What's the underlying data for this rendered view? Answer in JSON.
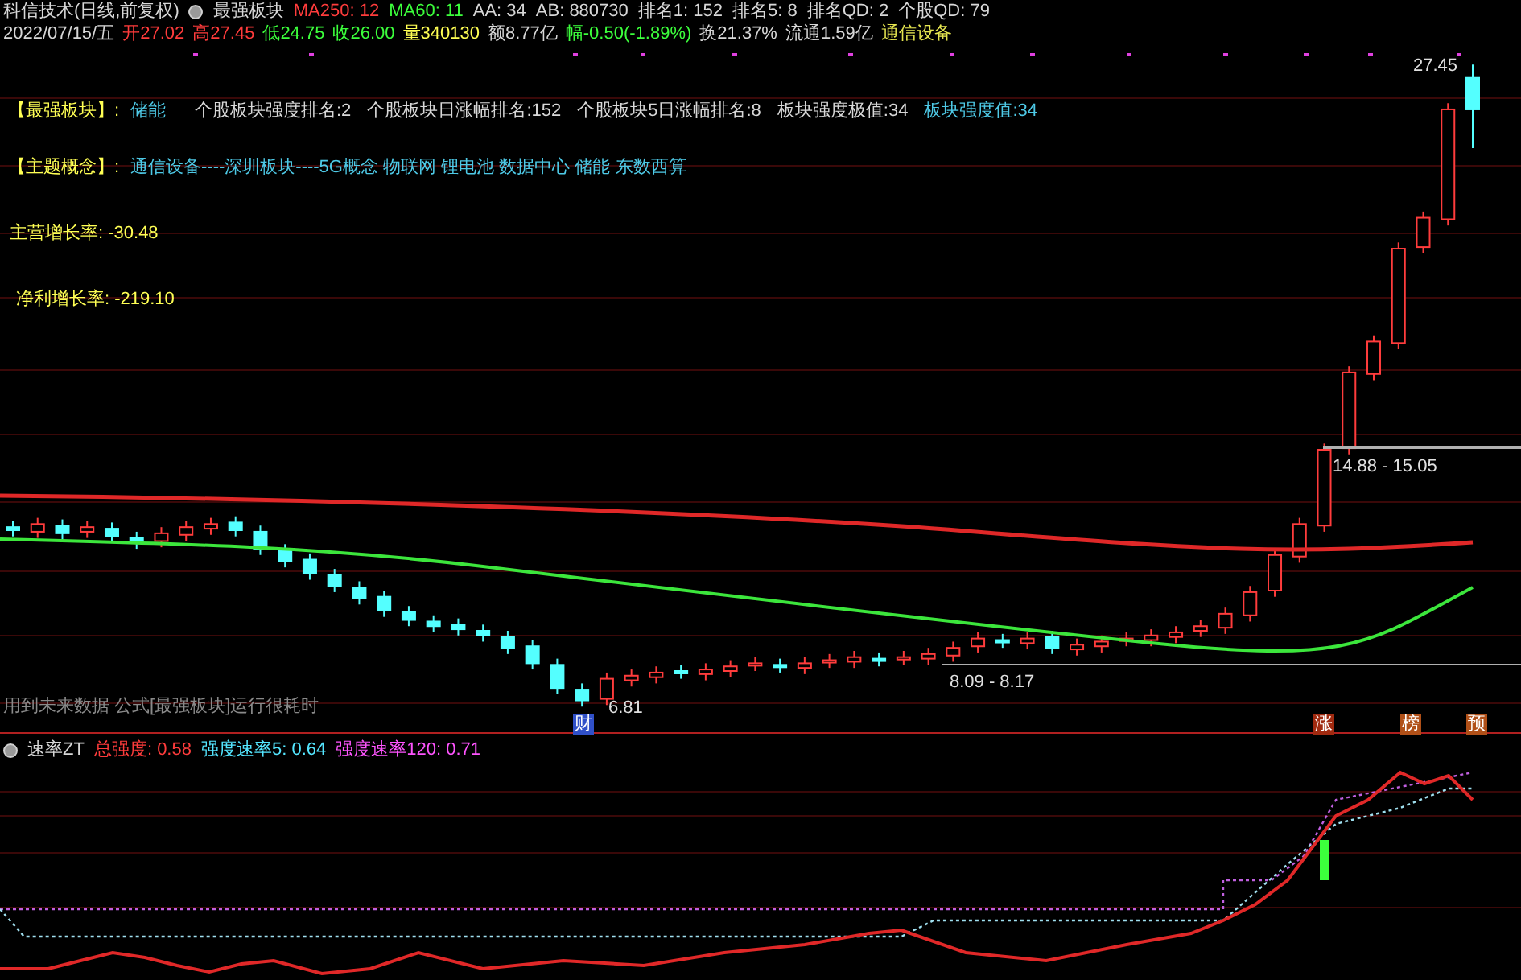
{
  "header": {
    "items": [
      {
        "text": "科信技术(日线,前复权)",
        "color": "#d8d8d8"
      },
      {
        "text": "最强板块",
        "color": "#d8d8d8"
      },
      {
        "text": "MA250: 12",
        "color": "#ff3c3c"
      },
      {
        "text": "MA60: 11",
        "color": "#3cff3c"
      },
      {
        "text": "AA: 34",
        "color": "#d8d8d8"
      },
      {
        "text": "AB: 880730",
        "color": "#d8d8d8"
      },
      {
        "text": "排名1: 152",
        "color": "#d8d8d8"
      },
      {
        "text": "排名5: 8",
        "color": "#d8d8d8"
      },
      {
        "text": "排名QD: 2",
        "color": "#d8d8d8"
      },
      {
        "text": "个股QD: 79",
        "color": "#d8d8d8"
      }
    ]
  },
  "quote": [
    {
      "text": "2022/07/15/五",
      "color": "#d8d8d8"
    },
    {
      "text": "开27.02",
      "color": "#ff3c3c"
    },
    {
      "text": "高27.45",
      "color": "#ff3c3c"
    },
    {
      "text": "低24.75",
      "color": "#3cff3c"
    },
    {
      "text": "收26.00",
      "color": "#3cff3c"
    },
    {
      "text": "量340130",
      "color": "#ffff54"
    },
    {
      "text": "额8.77亿",
      "color": "#d8d8d8"
    },
    {
      "text": "幅-0.50(-1.89%)",
      "color": "#3cff3c"
    },
    {
      "text": "换21.37%",
      "color": "#d8d8d8"
    },
    {
      "text": "流通1.59亿",
      "color": "#d8d8d8"
    },
    {
      "text": "通信设备",
      "color": "#e6e650"
    }
  ],
  "info": {
    "sector": {
      "label": "【最强板块】:",
      "value": "储能"
    },
    "rankings": [
      {
        "text": "个股板块强度排名:2",
        "highlight": false
      },
      {
        "text": "个股板块日涨幅排名:152",
        "highlight": false
      },
      {
        "text": "个股板块5日涨幅排名:8",
        "highlight": false
      },
      {
        "text": "板块强度极值:34",
        "highlight": false
      },
      {
        "text": "板块强度值:34",
        "highlight": true
      }
    ],
    "concepts": {
      "label": "【主题概念】:",
      "value": "通信设备----深圳板块----5G概念 物联网 锂电池 数据中心 储能 东数西算"
    },
    "metrics": [
      "主营增长率: -30.48",
      "净利增长率: -219.10"
    ]
  },
  "price_labels": {
    "high": "27.45",
    "upper_range": "14.88 - 15.05",
    "lower_range": "8.09 - 8.17",
    "low": "6.81"
  },
  "notice": "用到未来数据 公式[最强板块]运行很耗时",
  "markers": [
    {
      "text": "财",
      "color": "#3050c8"
    },
    {
      "text": "涨",
      "color": "#a02a10"
    },
    {
      "text": "榜",
      "color": "#b05018"
    },
    {
      "text": "预",
      "color": "#b05018"
    }
  ],
  "sub_chart": {
    "title": "速率ZT",
    "items": [
      {
        "text": "总强度: 0.58",
        "color": "#ff3c3c"
      },
      {
        "text": "强度速率5: 0.64",
        "color": "#54e6ff"
      },
      {
        "text": "强度速率120: 0.71",
        "color": "#ff54ff"
      }
    ]
  }
}
